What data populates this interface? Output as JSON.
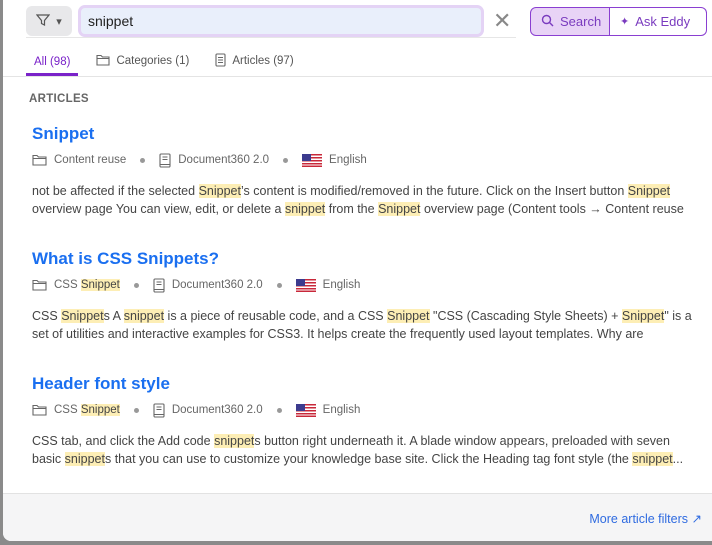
{
  "search": {
    "value": "snippet",
    "clear_icon": "close-icon",
    "search_label": "Search",
    "ask_label": "Ask Eddy"
  },
  "tabs": [
    {
      "label": "All (98)",
      "active": true
    },
    {
      "label": "Categories (1)",
      "icon": "folder-icon"
    },
    {
      "label": "Articles (97)",
      "icon": "document-icon"
    }
  ],
  "section_label": "ARTICLES",
  "results": [
    {
      "title": "Snippet",
      "category": "Content reuse",
      "project": "Document360 2.0",
      "language": "English",
      "category_parts": [
        [
          "Content reuse",
          false
        ]
      ],
      "lines": [
        [
          [
            "not be affected if the selected ",
            false
          ],
          [
            "Snippet",
            true
          ],
          [
            "’s content is modified/removed in the future. Click on the Insert button ",
            false
          ],
          [
            "Snippet",
            true
          ]
        ],
        [
          [
            "overview page You can view, edit, or delete a ",
            false
          ],
          [
            "snippet",
            true
          ],
          [
            " from the ",
            false
          ],
          [
            "Snippet",
            true
          ],
          [
            " overview page (Content tools → Content reuse",
            false
          ]
        ]
      ]
    },
    {
      "title": "What is CSS Snippets?",
      "project": "Document360 2.0",
      "language": "English",
      "category_parts": [
        [
          "CSS ",
          false
        ],
        [
          "Snippet",
          true
        ]
      ],
      "lines": [
        [
          [
            "CSS ",
            false
          ],
          [
            "Snippet",
            true
          ],
          [
            "s A ",
            false
          ],
          [
            "snippet",
            true
          ],
          [
            " is a piece of reusable code, and a CSS ",
            false
          ],
          [
            "Snippet",
            true
          ],
          [
            " \"CSS (Cascading Style Sheets) + ",
            false
          ],
          [
            "Snippet",
            true
          ],
          [
            "\" is a",
            false
          ]
        ],
        [
          [
            "set of utilities and interactive examples for CSS3. It helps create the frequently used layout templates. Why are",
            false
          ]
        ]
      ]
    },
    {
      "title": "Header font style",
      "project": "Document360 2.0",
      "language": "English",
      "category_parts": [
        [
          "CSS ",
          false
        ],
        [
          "Snippet",
          true
        ]
      ],
      "lines": [
        [
          [
            "CSS tab, and click the Add code ",
            false
          ],
          [
            "snippet",
            true
          ],
          [
            "s button right underneath it. A blade window appears, preloaded with seven",
            false
          ]
        ],
        [
          [
            "basic ",
            false
          ],
          [
            "snippet",
            true
          ],
          [
            "s that you can use to customize your knowledge base site. Click the Heading tag font style (the ",
            false
          ],
          [
            "snippet",
            true
          ],
          [
            "...",
            false
          ]
        ]
      ]
    }
  ],
  "footer": {
    "more_filters": "More article filters"
  },
  "colors": {
    "accent": "#7a22c9",
    "link": "#1a6ff0",
    "highlight": "#fdeeb5"
  }
}
